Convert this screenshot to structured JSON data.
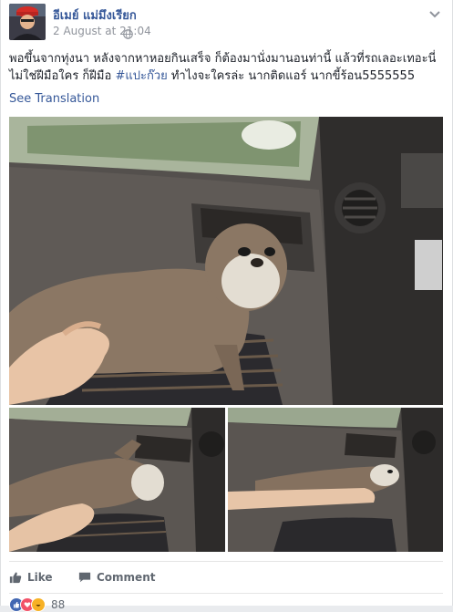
{
  "post": {
    "author": "อีเมย์ แม่มึงเรียก",
    "timestamp": "2 August at 21:04",
    "text_part1": "พอขึ้นจากทุ่งนา หลังจากหาหอยกินเสร็จ ก็ต้องมานั่งมานอนท่านี้ แล้วที่รถเลอะเทอะนี่ ไม่ใช่ฝีมือใคร ก็ฝีมือ ",
    "hashtag": "#แปะก๊วย",
    "text_part2": " ทำไงจะใครล่ะ นากติดแอร์ นากขี้ร้อน5555555",
    "see_translation": "See Translation"
  },
  "icons": {
    "avatar": "profile-avatar",
    "privacy": "globe-icon",
    "menu": "chevron-down-icon",
    "like": "thumbs-up-icon",
    "comment": "speech-bubble-icon"
  },
  "actions": {
    "like_label": "Like",
    "comment_label": "Comment"
  },
  "reactions": {
    "count": "88",
    "types": [
      "like",
      "love",
      "haha"
    ]
  },
  "colors": {
    "link": "#365899",
    "meta": "#90949c",
    "action": "#606770",
    "like_blue": "#4267b2",
    "love_red": "#f25268",
    "haha_yellow": "#f7b125"
  }
}
